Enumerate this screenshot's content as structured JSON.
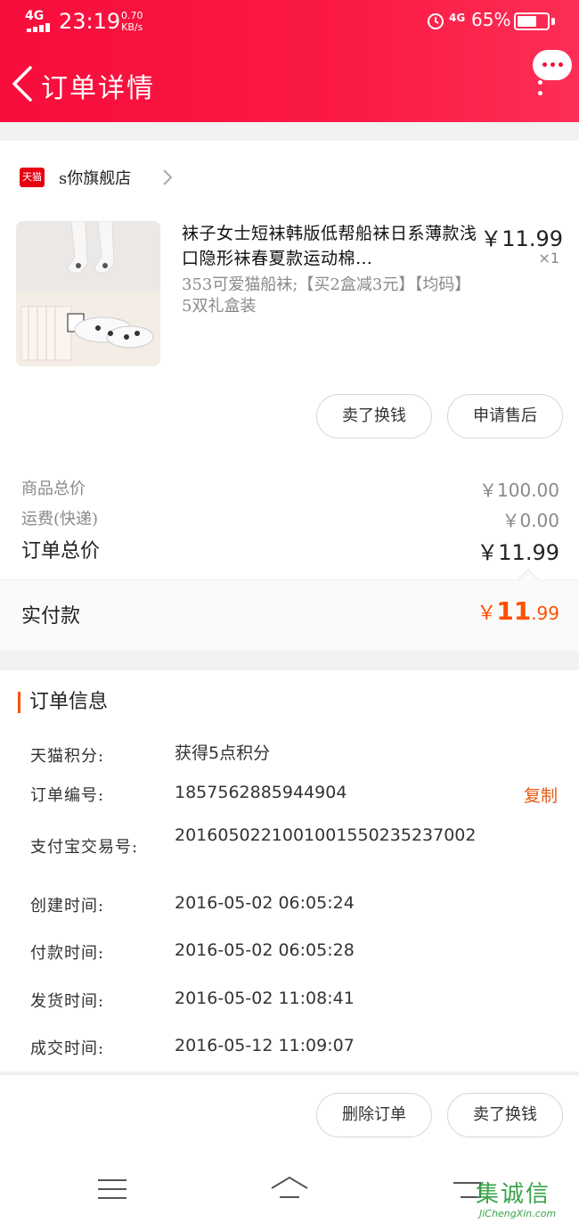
{
  "status_bar": {
    "signal": "4G",
    "time": "23:19",
    "speed_value": "0.70",
    "speed_unit": "KB/s",
    "network": "4G",
    "battery": "65%",
    "battery_level": 0.65
  },
  "header": {
    "title": "订单详情",
    "back_icon": "chevron-left-icon",
    "chat_icon": "chat-bubble-icon",
    "more_icon": "more-vertical-icon"
  },
  "shop": {
    "badge": "天猫",
    "name": "s你旗舰店"
  },
  "product": {
    "title": "袜子女士短袜韩版低帮船袜日系薄款浅口隐形袜春夏款运动棉…",
    "spec": "353可爱猫船袜;【买2盒减3元】【均码】5双礼盒装",
    "price": "￥11.99",
    "quantity": "×1"
  },
  "product_actions": {
    "sell_label": "卖了换钱",
    "after_sale_label": "申请售后"
  },
  "summary": {
    "goods_total_label": "商品总价",
    "goods_total_value": "￥100.00",
    "shipping_label": "运费(快递)",
    "shipping_value": "￥0.00",
    "order_total_label": "订单总价",
    "order_total_value": "￥11.99",
    "paid_label": "实付款",
    "paid_currency": "￥",
    "paid_int": "11",
    "paid_dec": ".99"
  },
  "order_info": {
    "title": "订单信息",
    "rows": [
      {
        "key": "天猫积分:",
        "value": "获得5点积分"
      },
      {
        "key": "订单编号:",
        "value": "1857562885944904",
        "action": "复制"
      },
      {
        "key": "支付宝交易号:",
        "value": "2016050221001001550235237002"
      },
      {
        "key": "创建时间:",
        "value": "2016-05-02 06:05:24"
      },
      {
        "key": "付款时间:",
        "value": "2016-05-02 06:05:28"
      },
      {
        "key": "发货时间:",
        "value": "2016-05-02 11:08:41"
      },
      {
        "key": "成交时间:",
        "value": "2016-05-12 11:09:07"
      }
    ]
  },
  "bottom_actions": {
    "delete_label": "删除订单",
    "sell_label": "卖了换钱"
  },
  "watermark": {
    "logo": "集诚信",
    "url": "JiChengXin.com"
  },
  "colors": {
    "brand": "#f70d3b",
    "accent": "#ff5000"
  }
}
